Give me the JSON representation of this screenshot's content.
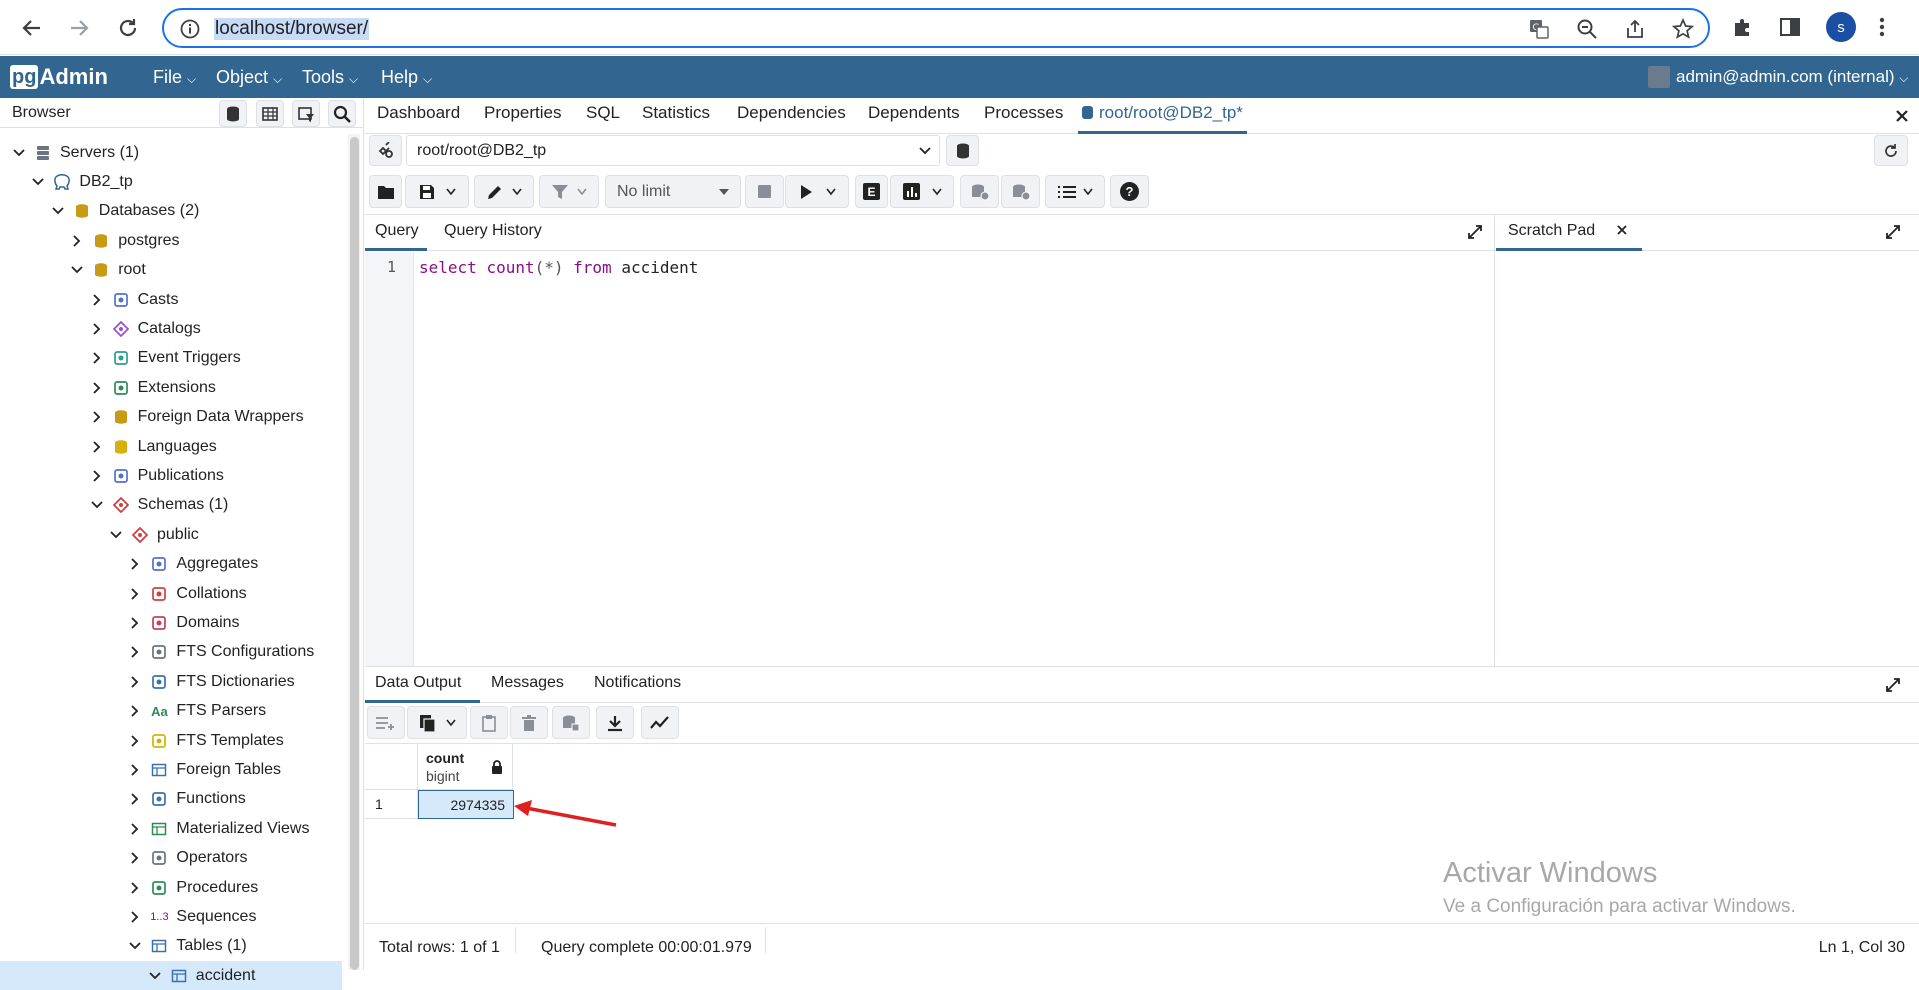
{
  "browser": {
    "url": "localhost/browser/",
    "profile_initial": "s"
  },
  "app": {
    "logo_pg": "pg",
    "logo_admin": "Admin",
    "menus": [
      "File",
      "Object",
      "Tools",
      "Help"
    ],
    "user": "admin@admin.com (internal)"
  },
  "left_panel": {
    "title": "Browser",
    "tree": [
      {
        "label": "Servers (1)",
        "expanded": true,
        "icon": "servers-icon"
      },
      {
        "label": "DB2_tp",
        "expanded": true,
        "icon": "server-elephant-icon"
      },
      {
        "label": "Databases (2)",
        "expanded": true,
        "icon": "databases-icon"
      },
      {
        "label": "postgres",
        "expanded": false,
        "icon": "database-icon"
      },
      {
        "label": "root",
        "expanded": true,
        "icon": "database-icon"
      },
      {
        "label": "Casts",
        "expanded": false,
        "icon": "casts-icon"
      },
      {
        "label": "Catalogs",
        "expanded": false,
        "icon": "catalogs-icon"
      },
      {
        "label": "Event Triggers",
        "expanded": false,
        "icon": "event-triggers-icon"
      },
      {
        "label": "Extensions",
        "expanded": false,
        "icon": "extensions-icon"
      },
      {
        "label": "Foreign Data Wrappers",
        "expanded": false,
        "icon": "fdw-icon"
      },
      {
        "label": "Languages",
        "expanded": false,
        "icon": "languages-icon"
      },
      {
        "label": "Publications",
        "expanded": false,
        "icon": "publications-icon"
      },
      {
        "label": "Schemas (1)",
        "expanded": true,
        "icon": "schemas-icon"
      },
      {
        "label": "public",
        "expanded": true,
        "icon": "schema-icon"
      },
      {
        "label": "Aggregates",
        "expanded": false,
        "icon": "aggregates-icon"
      },
      {
        "label": "Collations",
        "expanded": false,
        "icon": "collations-icon"
      },
      {
        "label": "Domains",
        "expanded": false,
        "icon": "domains-icon"
      },
      {
        "label": "FTS Configurations",
        "expanded": false,
        "icon": "fts-config-icon"
      },
      {
        "label": "FTS Dictionaries",
        "expanded": false,
        "icon": "fts-dictionaries-icon"
      },
      {
        "label": "FTS Parsers",
        "expanded": false,
        "icon": "fts-parsers-icon"
      },
      {
        "label": "FTS Templates",
        "expanded": false,
        "icon": "fts-templates-icon"
      },
      {
        "label": "Foreign Tables",
        "expanded": false,
        "icon": "foreign-tables-icon"
      },
      {
        "label": "Functions",
        "expanded": false,
        "icon": "functions-icon"
      },
      {
        "label": "Materialized Views",
        "expanded": false,
        "icon": "mat-views-icon"
      },
      {
        "label": "Operators",
        "expanded": false,
        "icon": "operators-icon"
      },
      {
        "label": "Procedures",
        "expanded": false,
        "icon": "procedures-icon"
      },
      {
        "label": "Sequences",
        "expanded": false,
        "icon": "sequences-icon"
      },
      {
        "label": "Tables (1)",
        "expanded": true,
        "icon": "tables-icon"
      },
      {
        "label": "accident",
        "expanded": true,
        "icon": "table-icon",
        "selected": true
      }
    ],
    "fts_parsers_glyph": "Aa",
    "sequences_glyph": "1..3"
  },
  "main_tabs": [
    "Dashboard",
    "Properties",
    "SQL",
    "Statistics",
    "Dependencies",
    "Dependents",
    "Processes",
    "root/root@DB2_tp*"
  ],
  "connection": "root/root@DB2_tp",
  "toolbar": {
    "limit": "No limit",
    "explain_glyph": "E",
    "help_glyph": "?"
  },
  "editor": {
    "tabs": [
      "Query",
      "Query History"
    ],
    "scratch_pad": "Scratch Pad",
    "line_number": "1",
    "code_kw1": "select",
    "code_fn": "count",
    "code_args": "(*)",
    "code_kw2": "from",
    "code_table": "accident"
  },
  "output": {
    "tabs": [
      "Data Output",
      "Messages",
      "Notifications"
    ],
    "column_name": "count",
    "column_type": "bigint",
    "row_number": "1",
    "cell_value": "2974335"
  },
  "status": {
    "rows": "Total rows: 1 of 1",
    "query": "Query complete 00:00:01.979",
    "position": "Ln 1, Col 30"
  },
  "watermark": {
    "line1": "Activar Windows",
    "line2": "Ve a Configuración para activar Windows."
  },
  "colors": {
    "header": "#326690",
    "accent": "#326690",
    "selected_row": "#d6e9fb",
    "annotation": "#e02020"
  }
}
